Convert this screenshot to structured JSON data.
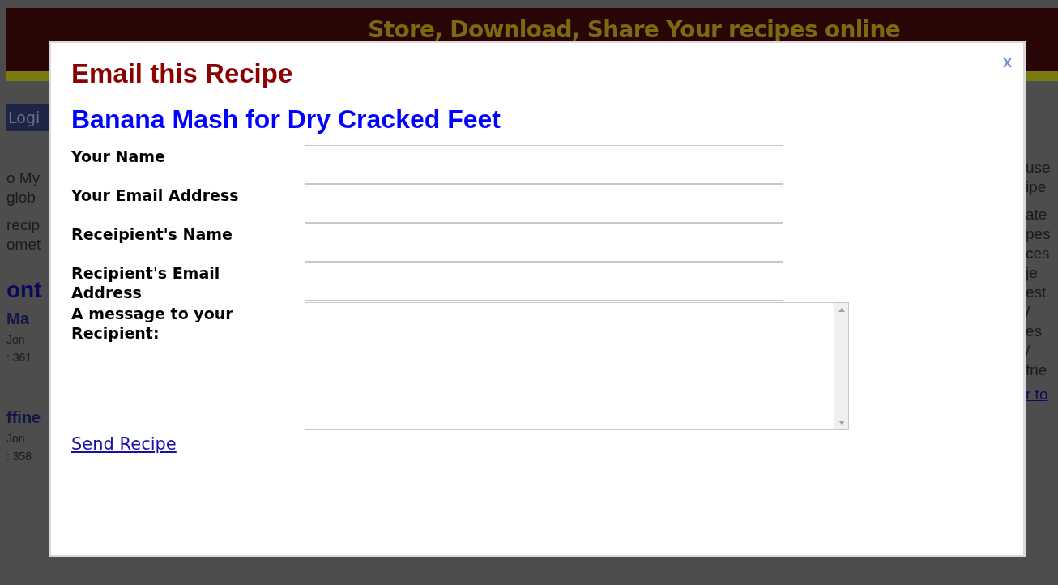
{
  "background": {
    "banner_text": "Store, Download, Share Your recipes online",
    "login_button": "Logi",
    "left_fragments": [
      {
        "kind": "text",
        "text": "o My"
      },
      {
        "kind": "text",
        "text": "glob"
      },
      {
        "kind": "text",
        "text": "recip"
      },
      {
        "kind": "text",
        "text": "omet"
      },
      {
        "kind": "heading",
        "text": "ont"
      },
      {
        "kind": "title",
        "text": "Ma"
      },
      {
        "kind": "small",
        "text": "Jon"
      },
      {
        "kind": "small",
        "text": ": 361"
      },
      {
        "kind": "title",
        "text": "ffine"
      },
      {
        "kind": "small",
        "text": "Jon"
      },
      {
        "kind": "small",
        "text": ": 358"
      }
    ],
    "right_fragments": [
      {
        "kind": "text",
        "text": "use"
      },
      {
        "kind": "text",
        "text": "ipe"
      },
      {
        "kind": "text",
        "text": "ate"
      },
      {
        "kind": "text",
        "text": "pes"
      },
      {
        "kind": "text",
        "text": "ces"
      },
      {
        "kind": "text",
        "text": "je"
      },
      {
        "kind": "text",
        "text": "est"
      },
      {
        "kind": "text",
        "text": "/"
      },
      {
        "kind": "text",
        "text": "es"
      },
      {
        "kind": "text",
        "text": "/"
      },
      {
        "kind": "text",
        "text": "frie"
      },
      {
        "kind": "link",
        "text": "r to"
      }
    ]
  },
  "dialog": {
    "title": "Email this Recipe",
    "close": "x",
    "recipe_name": "Banana Mash for Dry Cracked Feet",
    "fields": [
      {
        "kind": "input",
        "label": "Your Name"
      },
      {
        "kind": "input",
        "label": "Your Email Address"
      },
      {
        "kind": "input",
        "label": "Receipient's Name"
      },
      {
        "kind": "input",
        "label": "Recipient's Email Address"
      },
      {
        "kind": "textarea",
        "label": "A message to your Recipient:"
      }
    ],
    "send_link": "Send Recipe"
  }
}
